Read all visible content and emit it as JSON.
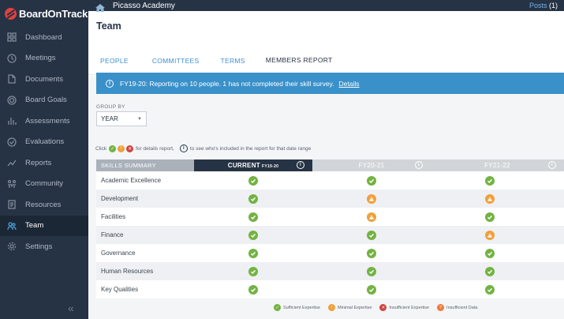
{
  "brand": {
    "name": "BoardOnTrack"
  },
  "topbar": {
    "org_name": "Picasso Academy",
    "posts_label": "Posts",
    "posts_count": "(1)"
  },
  "sidebar": {
    "items": [
      {
        "label": "Dashboard",
        "icon": "grid-icon"
      },
      {
        "label": "Meetings",
        "icon": "clock-icon"
      },
      {
        "label": "Documents",
        "icon": "document-icon"
      },
      {
        "label": "Board Goals",
        "icon": "target-icon"
      },
      {
        "label": "Assessments",
        "icon": "bar-chart-icon"
      },
      {
        "label": "Evaluations",
        "icon": "check-circle-icon"
      },
      {
        "label": "Reports",
        "icon": "trend-line-icon"
      },
      {
        "label": "Community",
        "icon": "community-icon"
      },
      {
        "label": "Resources",
        "icon": "book-icon"
      },
      {
        "label": "Team",
        "icon": "people-icon",
        "active": true
      },
      {
        "label": "Settings",
        "icon": "gear-icon"
      }
    ],
    "collapse_glyph": "«"
  },
  "page": {
    "title": "Team"
  },
  "tabs": [
    {
      "label": "PEOPLE"
    },
    {
      "label": "COMMITTEES"
    },
    {
      "label": "TERMS"
    },
    {
      "label": "MEMBERS REPORT",
      "active": true
    }
  ],
  "banner": {
    "icon": "info-icon",
    "text": "FY19-20:  Reporting on 10 people. 1 has not completed their skill survey.",
    "link": "Details"
  },
  "group_by": {
    "label": "GROUP BY",
    "value": "YEAR"
  },
  "hint": {
    "prefix": "Click",
    "middle": "for details report,",
    "suffix": "to see who's included in the report for that date range"
  },
  "table": {
    "label_header": "SKILLS SUMMARY",
    "columns": [
      {
        "label": "CURRENT",
        "sub": "FY19-20"
      },
      {
        "label": "FY20-21",
        "sub": ""
      },
      {
        "label": "FY21-22",
        "sub": ""
      }
    ],
    "rows": [
      {
        "label": "Academic Excellence",
        "values": [
          "ok",
          "ok",
          "ok"
        ]
      },
      {
        "label": "Development",
        "values": [
          "ok",
          "min",
          "min"
        ]
      },
      {
        "label": "Facilities",
        "values": [
          "ok",
          "min",
          "ok"
        ]
      },
      {
        "label": "Finance",
        "values": [
          "ok",
          "ok",
          "min"
        ]
      },
      {
        "label": "Governance",
        "values": [
          "ok",
          "ok",
          "ok"
        ]
      },
      {
        "label": "Human Resources",
        "values": [
          "ok",
          "ok",
          "ok"
        ]
      },
      {
        "label": "Key Qualities",
        "values": [
          "ok",
          "ok",
          "ok"
        ]
      }
    ]
  },
  "legend": [
    {
      "label": "Sufficient Expertise",
      "color": "#72b342"
    },
    {
      "label": "Minimal Expertise",
      "color": "#f0a03a"
    },
    {
      "label": "Insufficient Expertise",
      "color": "#d0433b"
    },
    {
      "label": "Insufficient Data",
      "color": "#f07a3a"
    }
  ],
  "colors": {
    "sidebar": "#263344",
    "accent": "#3a91c9",
    "ok": "#72b342",
    "minimal": "#f0a03a",
    "insufficient": "#d0433b",
    "no_data": "#f07a3a"
  }
}
